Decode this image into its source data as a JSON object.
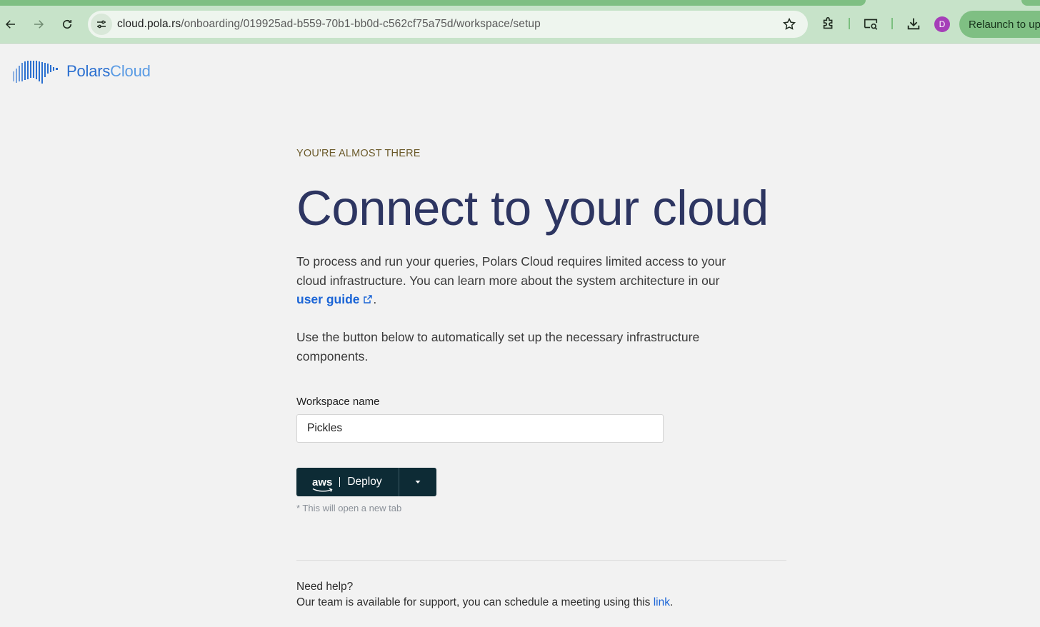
{
  "browser": {
    "url_host": "cloud.pola.rs",
    "url_path": "/onboarding/019925ad-b559-70b1-bb0d-c562cf75a75d/workspace/setup",
    "profile_initial": "D",
    "relaunch_label": "Relaunch to update",
    "icons": [
      "back-icon",
      "forward-icon",
      "reload-icon",
      "site-info-icon",
      "bookmark-star-icon",
      "extensions-icon",
      "cast-icon",
      "download-icon"
    ]
  },
  "brand": {
    "name_primary": "Polars",
    "name_secondary": "Cloud",
    "colors": {
      "primary": "#2a6fd0",
      "secondary": "#5a9be4",
      "heading": "#2d3561",
      "button": "#0d2b35",
      "link": "#1a64d6"
    }
  },
  "onboarding": {
    "eyebrow": "YOU'RE ALMOST THERE",
    "title": "Connect to your cloud",
    "intro_before_link": "To process and run your queries, Polars Cloud requires limited access to your cloud infrastructure. You can learn more about the system architecture in our ",
    "intro_link": "user guide",
    "intro_after_link": ".",
    "instructions": "Use the button below to automatically set up the necessary infrastructure components.",
    "workspace_label": "Workspace name",
    "workspace_value": "Pickles",
    "provider_label": "aws",
    "deploy_label": "Deploy",
    "note": "* This will open a new tab"
  },
  "help": {
    "title": "Need help?",
    "text_before_link": "Our team is available for support, you can schedule a meeting using this ",
    "link": "link",
    "text_after_link": "."
  }
}
